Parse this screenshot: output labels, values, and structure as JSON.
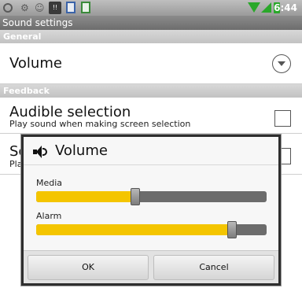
{
  "statusbar": {
    "clock": "6:44",
    "icons": [
      "sync-icon",
      "usb-icon",
      "android-icon",
      "notification-badge-icon",
      "doc-blue-icon",
      "doc-green-icon",
      "wifi-icon",
      "signal-icon",
      "battery-icon"
    ],
    "badge_text": "!!"
  },
  "titlebar": {
    "title": "Sound settings"
  },
  "categories": {
    "general": "General",
    "feedback": "Feedback"
  },
  "prefs": {
    "volume": {
      "title": "Volume"
    },
    "audible": {
      "title": "Audible selection",
      "summary": "Play sound when making screen selection"
    },
    "screen": {
      "title": "Sc",
      "summary": "Play"
    }
  },
  "dialog": {
    "title": "Volume",
    "media": {
      "label": "Media",
      "level": 0.43
    },
    "alarm": {
      "label": "Alarm",
      "level": 0.85
    },
    "ok_label": "OK",
    "cancel_label": "Cancel"
  },
  "colors": {
    "accent": "#f4c500",
    "wifi": "#2aa82a",
    "track": "#6c6c6c"
  }
}
